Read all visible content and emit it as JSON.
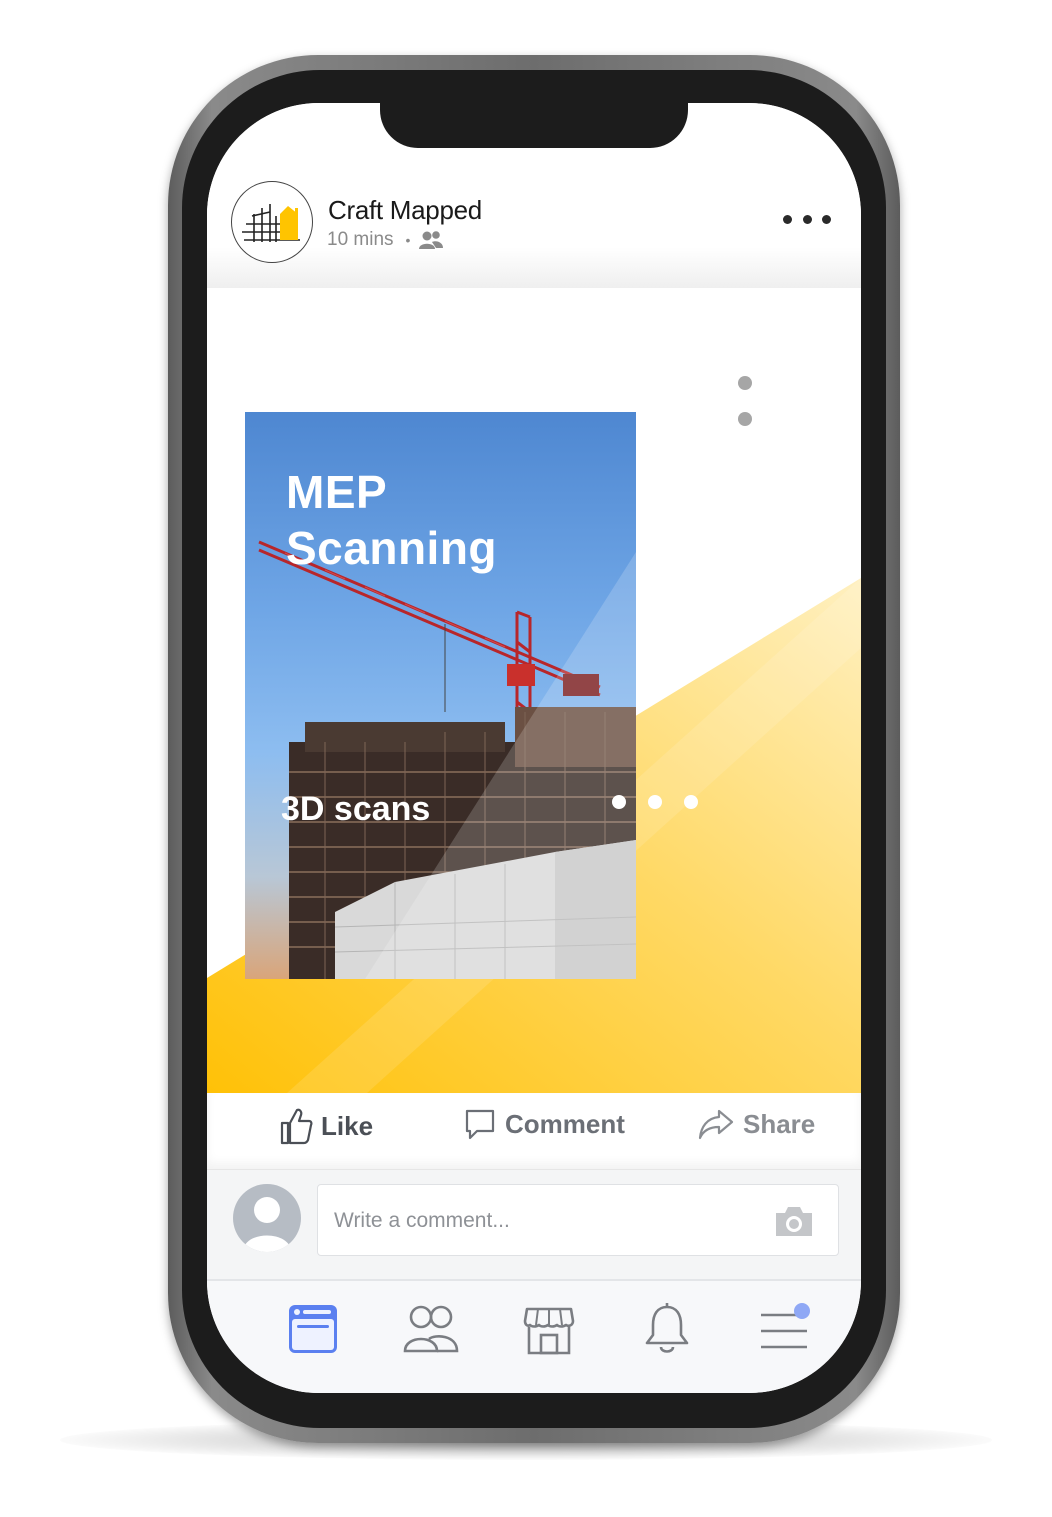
{
  "post": {
    "page_name": "Craft Mapped",
    "time": "10 mins",
    "audience_icon": "friends-icon"
  },
  "card": {
    "title": "MEP\nScanning",
    "subtitle": "3D scans"
  },
  "actions": {
    "like": "Like",
    "comment": "Comment",
    "share": "Share"
  },
  "comment_box": {
    "placeholder": "Write a comment..."
  },
  "tabs": [
    "news-feed-icon",
    "friends-icon",
    "marketplace-icon",
    "bell-icon",
    "menu-icon"
  ],
  "colors": {
    "accent_yellow": "#FFC400",
    "active_tab": "#5b80f0",
    "notification_dot": "#8fa8f5"
  }
}
